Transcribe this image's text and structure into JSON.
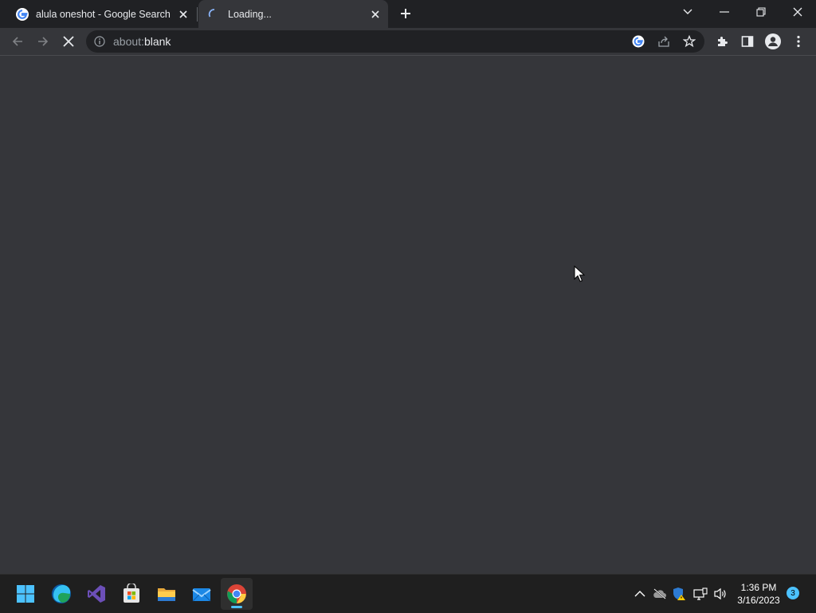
{
  "browser": {
    "tabs": [
      {
        "title": "alula oneshot - Google Search",
        "favicon": "google-icon",
        "active": false
      },
      {
        "title": "Loading...",
        "favicon": "loading-spinner-icon",
        "active": true
      }
    ],
    "new_tab_icon": "plus-icon",
    "window_controls": [
      "tab-search-icon",
      "minimize-icon",
      "restore-icon",
      "close-icon"
    ]
  },
  "toolbar": {
    "back_icon": "back-arrow-icon",
    "forward_icon": "forward-arrow-icon",
    "stop_icon": "stop-icon",
    "url_scheme": "about:",
    "url_host": "blank",
    "omnibox_icons": [
      "google-lens-icon",
      "share-icon",
      "bookmark-star-icon"
    ],
    "right_icons": [
      "extensions-icon",
      "side-panel-icon",
      "profile-icon",
      "menu-icon"
    ]
  },
  "taskbar": {
    "apps": [
      {
        "name": "Start",
        "icon": "windows-start-icon"
      },
      {
        "name": "Microsoft Edge",
        "icon": "edge-icon"
      },
      {
        "name": "Visual Studio",
        "icon": "visual-studio-icon"
      },
      {
        "name": "Microsoft Store",
        "icon": "store-icon"
      },
      {
        "name": "File Explorer",
        "icon": "file-explorer-icon"
      },
      {
        "name": "Mail",
        "icon": "mail-icon"
      },
      {
        "name": "Google Chrome",
        "icon": "chrome-icon",
        "active": true
      }
    ],
    "tray_icons": [
      "chevron-up-icon",
      "onedrive-icon",
      "defender-icon",
      "network-icon",
      "volume-icon"
    ],
    "time": "1:36 PM",
    "date": "3/16/2023",
    "notification_count": "3"
  },
  "colors": {
    "tabstrip": "#202124",
    "content": "#35363a",
    "taskbar": "#1f1f1f",
    "accent": "#4cc2ff"
  }
}
